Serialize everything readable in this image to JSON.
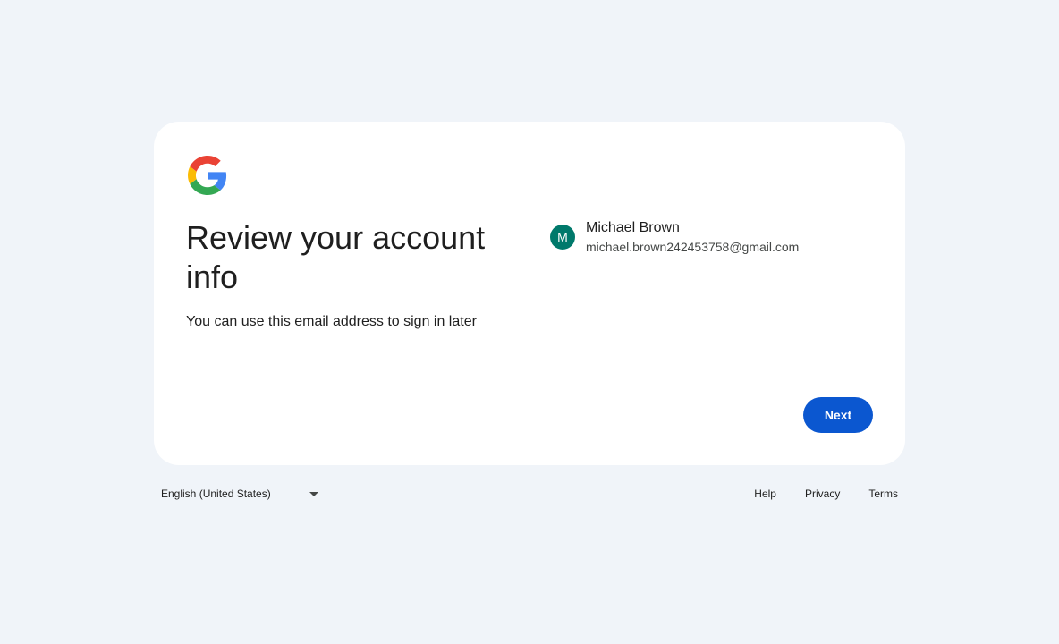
{
  "header": {
    "logo_icon": "google-g-logo-icon",
    "title": "Review your account info",
    "subtitle": "You can use this email address to sign in later"
  },
  "account": {
    "avatar_initial": "M",
    "avatar_color": "#00796b",
    "name": "Michael Brown",
    "email": "michael.brown242453758@gmail.com"
  },
  "actions": {
    "next_label": "Next",
    "accent_color": "#0b57d0"
  },
  "footer": {
    "language": "English (United States)",
    "links": [
      "Help",
      "Privacy",
      "Terms"
    ]
  }
}
